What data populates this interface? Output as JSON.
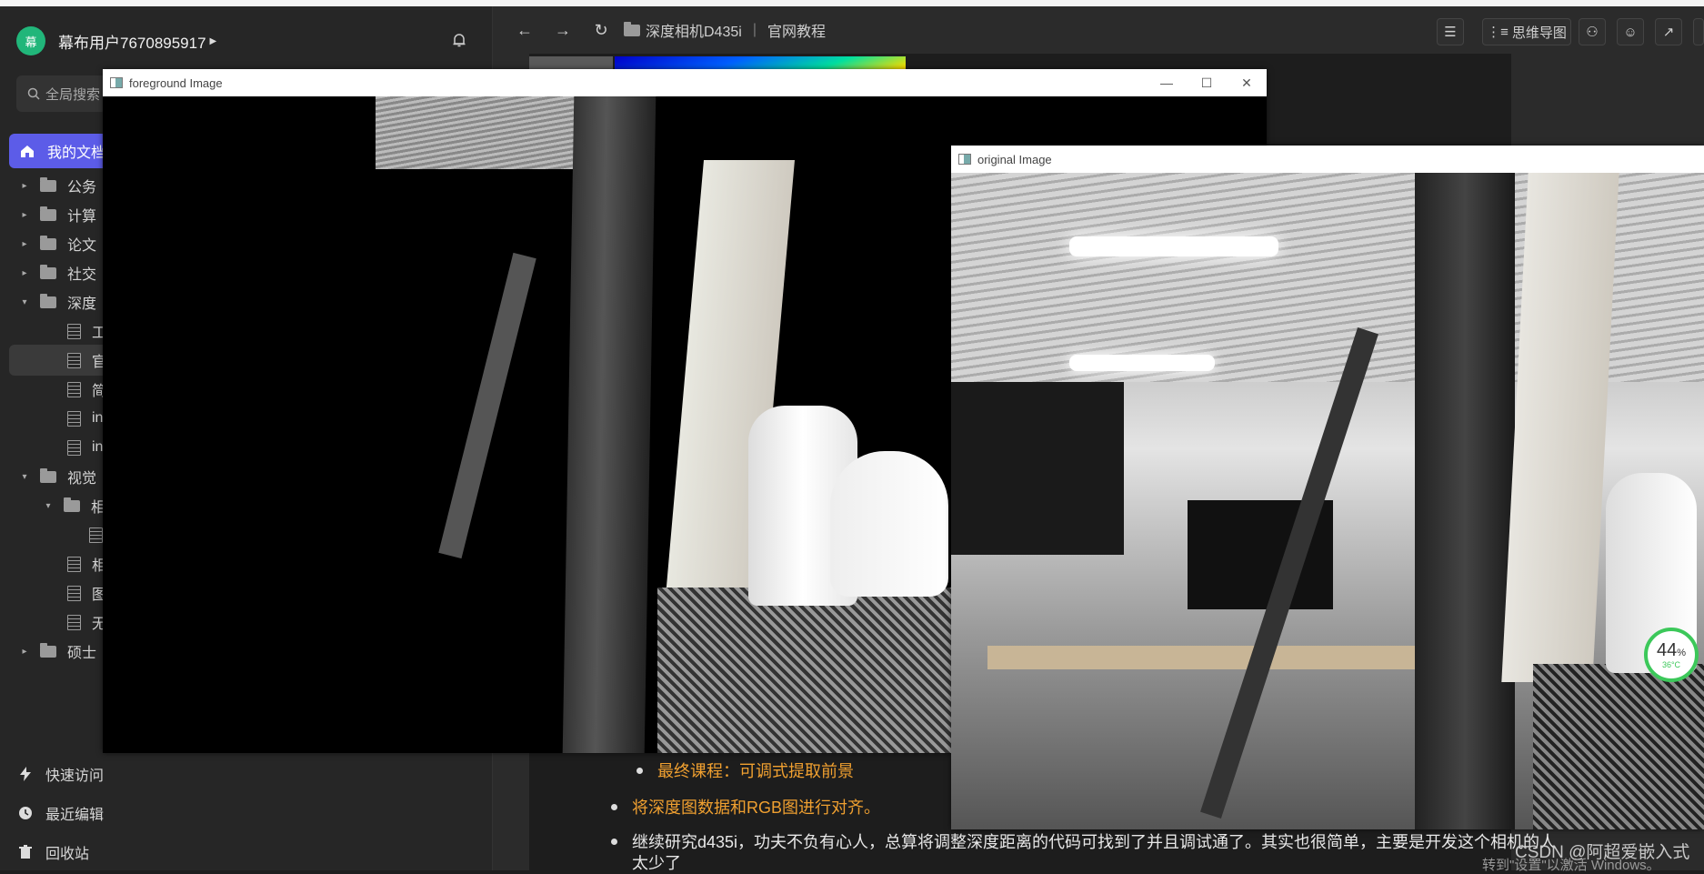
{
  "user": {
    "avatar": "幕",
    "name": "幕布用户7670895917"
  },
  "search": {
    "placeholder": "全局搜索"
  },
  "nav": {
    "mine": "我的文档"
  },
  "tree": [
    {
      "label": "公务",
      "type": "folder",
      "caret": "▸"
    },
    {
      "label": "计算",
      "type": "folder",
      "caret": "▸"
    },
    {
      "label": "论文",
      "type": "folder",
      "caret": "▸"
    },
    {
      "label": "社交",
      "type": "folder",
      "caret": "▸"
    },
    {
      "label": "深度",
      "type": "folder",
      "caret": "▾"
    },
    {
      "label": "工",
      "type": "doc"
    },
    {
      "label": "官",
      "type": "doc"
    },
    {
      "label": "简",
      "type": "doc"
    },
    {
      "label": "in",
      "type": "doc"
    },
    {
      "label": "in",
      "type": "doc"
    },
    {
      "label": "视觉",
      "type": "folder",
      "caret": "▾"
    },
    {
      "label": "相",
      "type": "folder",
      "caret": "▾"
    },
    {
      "label": "",
      "type": "doc"
    },
    {
      "label": "相",
      "type": "doc"
    },
    {
      "label": "图",
      "type": "doc"
    },
    {
      "label": "无",
      "type": "doc"
    },
    {
      "label": "硕士",
      "type": "folder",
      "caret": "▸"
    }
  ],
  "bottom_nav": {
    "quick": "快速访问",
    "recent": "最近编辑",
    "trash": "回收站"
  },
  "toolbar": {
    "crumb_folder": "深度相机D435i",
    "crumb_doc": "官网教程",
    "mindmap": "思维导图"
  },
  "windows": {
    "foreground": "foreground Image",
    "original": "original Image"
  },
  "bullets": {
    "b1": "最终课程：可调式提取前景",
    "b2": "将深度图数据和RGB图进行对齐。",
    "b3": "继续研究d435i，功夫不负有心人，总算将调整深度距离的代码可找到了并且调试通了。其实也很简单，主要是开发这个相机的人",
    "b3cont": "太少了"
  },
  "watermark": "CSDN @阿超爱嵌入式",
  "activate": "转到\"设置\"以激活 Windows。",
  "gauge": {
    "percent": "44",
    "unit": "%",
    "temp": "36°C"
  },
  "colors": {
    "accent": "#5c5ce8",
    "avatar": "#21b67a",
    "orange_text": "#f0a030"
  }
}
